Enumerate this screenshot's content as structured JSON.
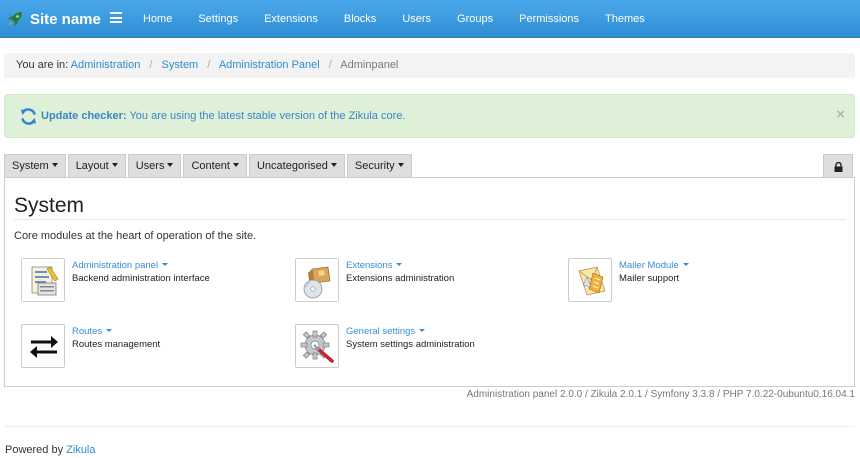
{
  "navbar": {
    "site_name": "Site name",
    "links": [
      "Home",
      "Settings",
      "Extensions",
      "Blocks",
      "Users",
      "Groups",
      "Permissions",
      "Themes"
    ]
  },
  "breadcrumb": {
    "prefix": "You are in:",
    "items": [
      "Administration",
      "System",
      "Administration Panel"
    ],
    "current": "Adminpanel"
  },
  "alert": {
    "label": "Update checker:",
    "message": "You are using the latest stable version of the Zikula core.",
    "close": "×"
  },
  "tabs": [
    "System",
    "Layout",
    "Users",
    "Content",
    "Uncategorised",
    "Security"
  ],
  "panel": {
    "title": "System",
    "description": "Core modules at the heart of operation of the site.",
    "modules": [
      {
        "title": "Administration panel",
        "subtitle": "Backend administration interface",
        "icon": "admin-panel-icon"
      },
      {
        "title": "Extensions",
        "subtitle": "Extensions administration",
        "icon": "extensions-icon"
      },
      {
        "title": "Mailer Module",
        "subtitle": "Mailer support",
        "icon": "mailer-icon"
      },
      {
        "title": "Routes",
        "subtitle": "Routes management",
        "icon": "routes-icon"
      },
      {
        "title": "General settings",
        "subtitle": "System settings administration",
        "icon": "general-settings-icon"
      }
    ]
  },
  "version_info": "Administration panel 2.0.0 / Zikula 2.0.1 / Symfony 3.3.8 / PHP 7.0.22-0ubuntu0.16.04.1",
  "footer": {
    "prefix": "Powered by",
    "link": "Zikula"
  },
  "colors": {
    "navbar": "#3b9de0",
    "link": "#2c8cd0",
    "alert_bg": "#dff0d8",
    "tab_bg": "#dedede"
  }
}
